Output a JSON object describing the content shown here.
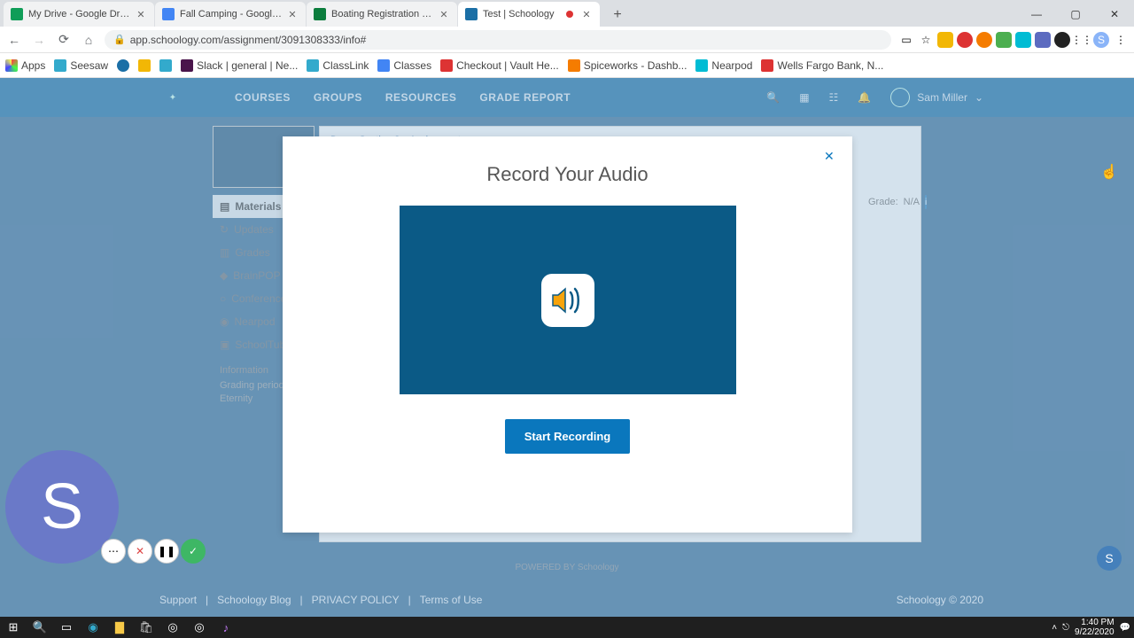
{
  "browser": {
    "tabs": [
      {
        "title": "My Drive - Google Drive",
        "favicon": "#0f9d58"
      },
      {
        "title": "Fall Camping - Google Docs",
        "favicon": "#4285f4"
      },
      {
        "title": "Boating Registration - DNREC A...",
        "favicon": "#0b7d3d"
      },
      {
        "title": "Test | Schoology",
        "favicon": "#1b6fa6",
        "active": true,
        "recording": true
      }
    ],
    "url": "app.schoology.com/assignment/3091308333/info#",
    "bookmarks": [
      {
        "label": "Apps",
        "color": "#f2b705"
      },
      {
        "label": "Seesaw",
        "color": "#3ac"
      },
      {
        "label": "",
        "color": "#1b6fa6"
      },
      {
        "label": "",
        "color": "#f2b705"
      },
      {
        "label": "",
        "color": "#3ac"
      },
      {
        "label": "Slack | general | Ne...",
        "color": "#4a154b"
      },
      {
        "label": "ClassLink",
        "color": "#3ac"
      },
      {
        "label": "Classes",
        "color": "#4285f4"
      },
      {
        "label": "Checkout | Vault He...",
        "color": "#d33"
      },
      {
        "label": "Spiceworks - Dashb...",
        "color": "#f57c00"
      },
      {
        "label": "Nearpod",
        "color": "#00bcd4"
      },
      {
        "label": "Wells Fargo Bank, N...",
        "color": "#d33"
      }
    ]
  },
  "nav": {
    "links": [
      "COURSES",
      "GROUPS",
      "RESOURCES",
      "GRADE REPORT"
    ],
    "user": "Sam Miller"
  },
  "sidebar": {
    "items": [
      {
        "label": "Materials",
        "active": true
      },
      {
        "label": "Updates"
      },
      {
        "label": "Grades"
      },
      {
        "label": "BrainPOP"
      },
      {
        "label": "Conferences"
      },
      {
        "label": "Nearpod"
      },
      {
        "label": "SchoolTube"
      }
    ],
    "info_heading": "Information",
    "info_l1": "Grading period",
    "info_l2": "Eternity"
  },
  "breadcrumb": "Demo Section 2 ▸ Assignments",
  "grade": {
    "label": "Grade:",
    "value": "N/A"
  },
  "modal": {
    "title": "Record Your Audio",
    "button": "Start Recording"
  },
  "footer": {
    "powered": "POWERED BY Schoology",
    "links": [
      "Support",
      "Schoology Blog",
      "PRIVACY POLICY",
      "Terms of Use"
    ],
    "copyright": "Schoology © 2020"
  },
  "orb": "S",
  "taskbar": {
    "time": "1:40 PM",
    "date": "9/22/2020"
  }
}
